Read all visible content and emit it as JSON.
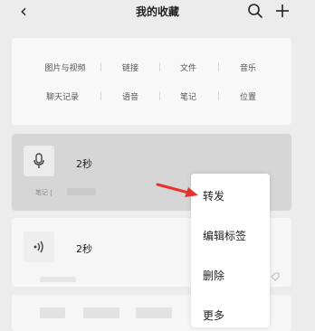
{
  "header": {
    "title": "我的收藏"
  },
  "categories": [
    [
      "图片与视频",
      "链接",
      "文件",
      "音乐"
    ],
    [
      "聊天记录",
      "语音",
      "笔记",
      "位置"
    ]
  ],
  "items": [
    {
      "duration": "2秒",
      "meta": "笔记 |"
    },
    {
      "duration": "2秒"
    }
  ],
  "context_menu": [
    "转发",
    "编辑标签",
    "删除",
    "更多"
  ],
  "colors": {
    "arrow": "#e8322f",
    "selected_bg": "#d6d6d6"
  }
}
